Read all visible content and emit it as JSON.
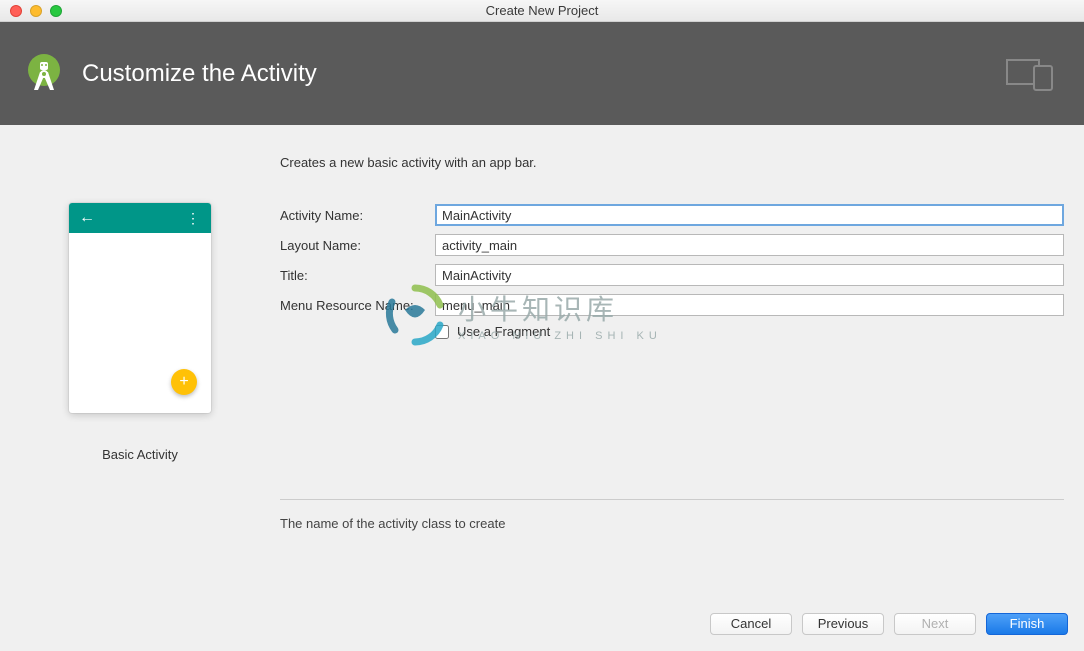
{
  "window": {
    "title": "Create New Project"
  },
  "banner": {
    "title": "Customize the Activity"
  },
  "preview": {
    "label": "Basic Activity"
  },
  "description": "Creates a new basic activity with an app bar.",
  "form": {
    "activity_name": {
      "label": "Activity Name:",
      "value": "MainActivity"
    },
    "layout_name": {
      "label": "Layout Name:",
      "value": "activity_main"
    },
    "title": {
      "label": "Title:",
      "value": "MainActivity"
    },
    "menu_resource": {
      "label": "Menu Resource Name:",
      "value": "menu_main"
    },
    "use_fragment": {
      "label": "Use a Fragment",
      "checked": false
    }
  },
  "hint": "The name of the activity class to create",
  "buttons": {
    "cancel": "Cancel",
    "previous": "Previous",
    "next": "Next",
    "finish": "Finish"
  },
  "watermark": {
    "cn": "小牛知识库",
    "en": "XIAO NIU ZHI SHI KU"
  }
}
